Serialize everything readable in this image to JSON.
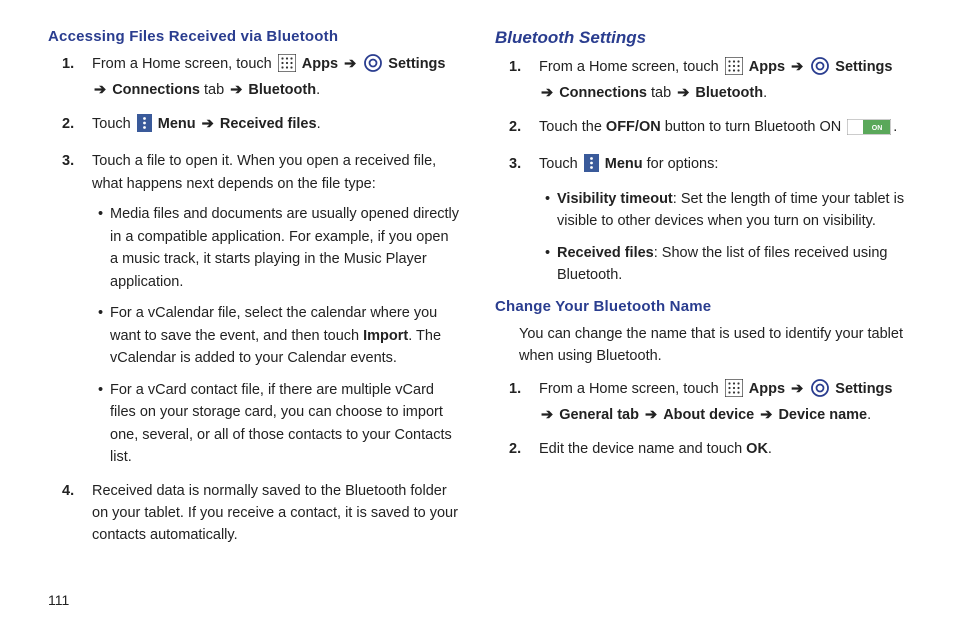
{
  "pageNumber": "111",
  "left": {
    "heading": "Accessing Files Received via Bluetooth",
    "step1_a": "From a Home screen, touch ",
    "step1_apps": "Apps",
    "step1_settings": "Settings",
    "step1_conn": "Connections",
    "step1_tab": " tab ",
    "step1_bt": "Bluetooth",
    "step2_a": "Touch ",
    "step2_menu": "Menu",
    "step2_rf": "Received files",
    "step3": "Touch a file to open it. When you open a received file, what happens next depends on the file type:",
    "b1": "Media files and documents are usually opened directly in a compatible application. For example, if you open a music track, it starts playing in the Music Player application.",
    "b2_a": "For a vCalendar file, select the calendar where you want to save the event, and then touch ",
    "b2_import": "Import",
    "b2_b": ". The vCalendar is added to your Calendar events.",
    "b3": "For a vCard contact file, if there are multiple vCard files on your storage card, you can choose to import one, several, or all of those contacts to your Contacts list.",
    "step4": "Received data is normally saved to the Bluetooth folder on your tablet. If you receive a contact, it is saved to your contacts automatically."
  },
  "right": {
    "heading1": "Bluetooth Settings",
    "s1_a": "From a Home screen, touch ",
    "s1_apps": "Apps",
    "s1_settings": "Settings",
    "s1_conn": "Connections",
    "s1_tab": " tab ",
    "s1_bt": "Bluetooth",
    "s2_a": "Touch the ",
    "s2_offon": "OFF/ON",
    "s2_b": " button to turn Bluetooth ON ",
    "s3_a": "Touch ",
    "s3_menu": "Menu",
    "s3_b": " for options:",
    "rb1_t": "Visibility timeout",
    "rb1": ": Set the length of time your tablet is visible to other devices when you turn on visibility.",
    "rb2_t": "Received files",
    "rb2": ": Show the list of files received using Bluetooth.",
    "heading2": "Change Your Bluetooth Name",
    "intro": "You can change the name that is used to identify your tablet when using Bluetooth.",
    "c1_a": "From a Home screen, touch ",
    "c1_apps": "Apps",
    "c1_settings": "Settings",
    "c1_gen": "General tab",
    "c1_about": "About device",
    "c1_dname": "Device name",
    "c2_a": "Edit the device name and touch ",
    "c2_ok": "OK"
  }
}
